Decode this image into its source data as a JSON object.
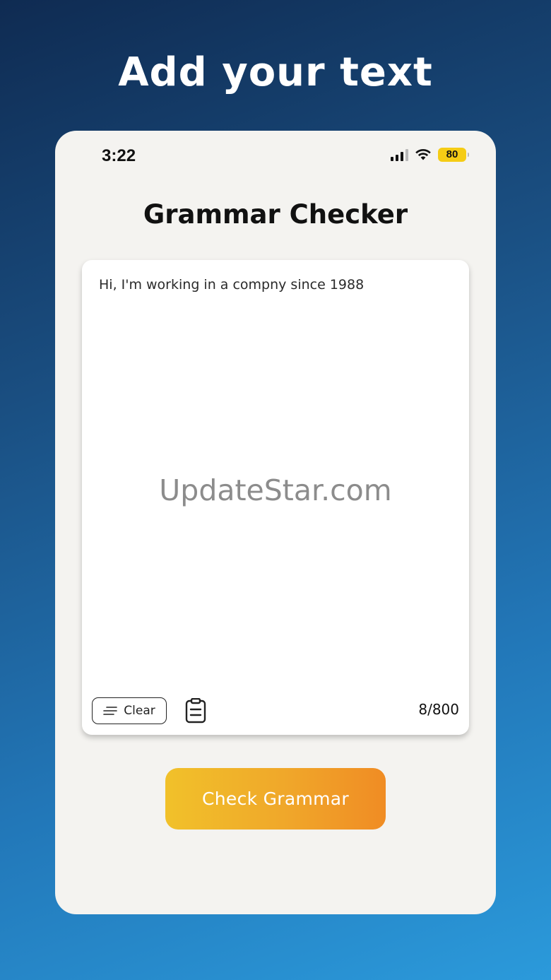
{
  "headline": "Add your text",
  "status_bar": {
    "time": "3:22",
    "battery": "80",
    "icons": [
      "signal-icon",
      "wifi-icon",
      "battery-icon"
    ]
  },
  "app": {
    "title": "Grammar Checker"
  },
  "editor": {
    "text": "Hi, I'm working in a compny since 1988",
    "clear_label": "Clear",
    "clear_icon": "lines-icon",
    "paste_icon": "clipboard-icon",
    "char_count": "8/800"
  },
  "action": {
    "check_label": "Check Grammar"
  },
  "watermark": "UpdateStar.com",
  "colors": {
    "battery": "#f5cc15",
    "button_start": "#f1c12a",
    "button_end": "#f08c24",
    "card_bg": "#f4f3f0"
  }
}
